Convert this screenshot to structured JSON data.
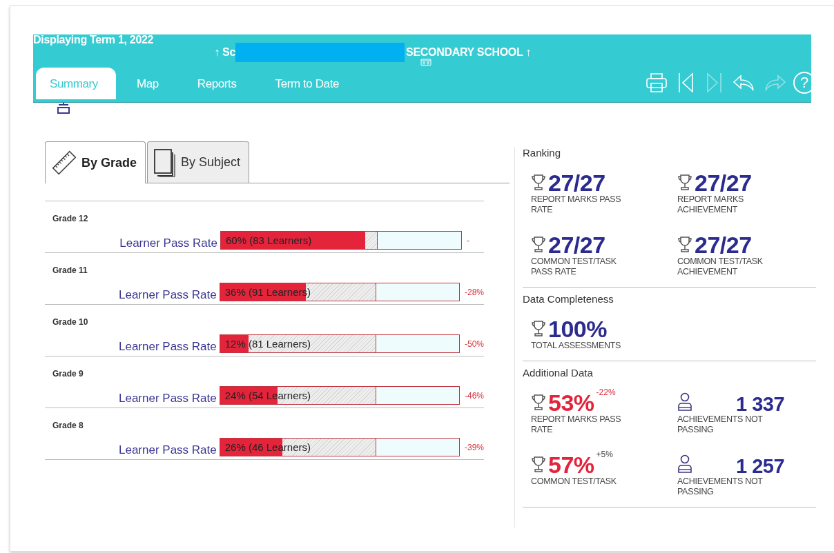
{
  "header": {
    "term": "Displaying Term 1, 2022",
    "school_prefix": "↑ Sc",
    "school_suffix": "SECONDARY SCHOOL ↑",
    "tabs": [
      {
        "label": "Summary",
        "selected": true
      },
      {
        "label": "Map",
        "selected": false
      },
      {
        "label": "Reports",
        "selected": false
      },
      {
        "label": "Term to Date",
        "selected": false
      }
    ],
    "tools": [
      {
        "kind": "print",
        "disabled": false
      },
      {
        "kind": "first",
        "disabled": false
      },
      {
        "kind": "last",
        "disabled": true
      },
      {
        "kind": "back",
        "disabled": false
      },
      {
        "kind": "forward",
        "disabled": true
      },
      {
        "kind": "help",
        "disabled": false,
        "label": "?"
      }
    ]
  },
  "view_tabs": [
    {
      "label": "By Grade",
      "kind": "ruler",
      "selected": true
    },
    {
      "label": "By Subject",
      "kind": "pages",
      "selected": false
    }
  ],
  "grades": [
    {
      "grade": "Grade 12",
      "label": "Learner Pass Rate",
      "bar": {
        "level": 0.6
      },
      "reference": {
        "level": 0.65
      },
      "reading": "60% (83 Learners)",
      "change": "-"
    },
    {
      "grade": "Grade 11",
      "label": "Learner Pass Rate",
      "bar": {
        "level": 0.36
      },
      "reference": {
        "level": 0.65
      },
      "reading": "36% (91 Learners)",
      "change": "-28%"
    },
    {
      "grade": "Grade 10",
      "label": "Learner Pass Rate",
      "bar": {
        "level": 0.12
      },
      "reference": {
        "level": 0.65
      },
      "reading": "12% (81 Learners)",
      "change": "-50%"
    },
    {
      "grade": "Grade 9",
      "label": "Learner Pass Rate",
      "bar": {
        "level": 0.24
      },
      "reference": {
        "level": 0.65
      },
      "reading": "24% (54 Learners)",
      "change": "-46%"
    },
    {
      "grade": "Grade 8",
      "label": "Learner Pass Rate",
      "bar": {
        "level": 0.26
      },
      "reference": {
        "level": 0.65
      },
      "reading": "26% (46 Learners)",
      "change": "-39%"
    }
  ],
  "sections": [
    {
      "title": "Ranking",
      "stats": [
        {
          "kind": "trophy",
          "color": "#2c2b8f",
          "value": "27/27",
          "label": "REPORT MARKS PASS RATE"
        },
        {
          "kind": "trophy",
          "color": "#2c2b8f",
          "value": "27/27",
          "label": "REPORT MARKS ACHIEVEMENT"
        },
        {
          "kind": "trophy",
          "color": "#2c2b8f",
          "value": "27/27",
          "label": "COMMON TEST/TASK PASS RATE"
        },
        {
          "kind": "trophy",
          "color": "#2c2b8f",
          "value": "27/27",
          "label": "COMMON TEST/TASK ACHIEVEMENT"
        }
      ]
    },
    {
      "title": "Data Completeness",
      "stats": [
        {
          "kind": "trophy",
          "color": "#2c2b8f",
          "value": "100%",
          "label": "TOTAL ASSESSMENTS"
        }
      ]
    },
    {
      "title": "Additional Data",
      "stats": [
        {
          "kind": "trophy",
          "color": "#e3243b",
          "value": "53%",
          "delta": {
            "text": "-22%",
            "color": "#e3243b"
          },
          "label": "REPORT MARKS PASS RATE"
        },
        {
          "kind": "person",
          "color": "#2c2b8f",
          "value": "1 337",
          "label": "ACHIEVEMENTS NOT PASSING"
        },
        {
          "kind": "trophy",
          "color": "#e3243b",
          "value": "57%",
          "delta": {
            "text": "+5%",
            "color": "#444444"
          },
          "label": "COMMON TEST/TASK"
        },
        {
          "kind": "person",
          "color": "#2c2b8f",
          "value": "1 257",
          "label": "ACHIEVEMENTS NOT PASSING"
        }
      ]
    }
  ]
}
